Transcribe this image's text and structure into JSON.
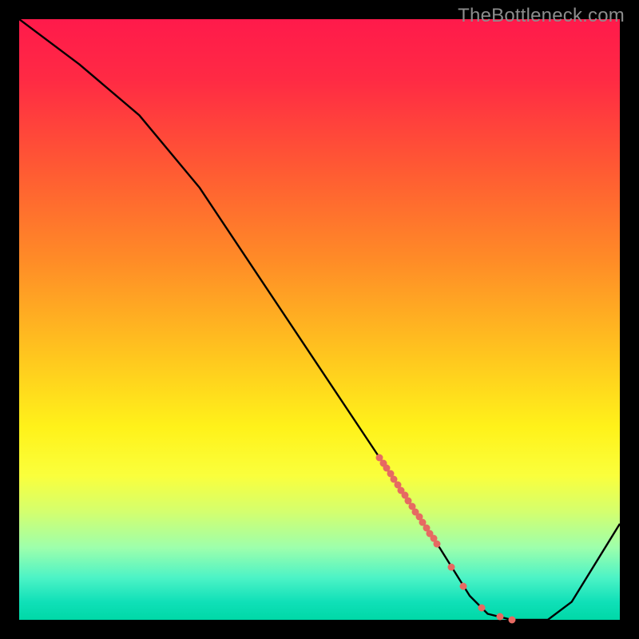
{
  "watermark": "TheBottleneck.com",
  "chart_data": {
    "type": "line",
    "title": "",
    "xlabel": "",
    "ylabel": "",
    "xlim": [
      0,
      100
    ],
    "ylim": [
      0,
      100
    ],
    "series": [
      {
        "name": "bottleneck-curve",
        "x": [
          0,
          10,
          20,
          30,
          40,
          50,
          60,
          70,
          75,
          78,
          82,
          88,
          92,
          100
        ],
        "y": [
          100,
          92.5,
          84,
          72,
          57,
          42,
          27,
          12,
          4,
          1,
          0,
          0,
          3,
          16
        ]
      }
    ],
    "markers": {
      "name": "highlight-dots",
      "x_start": 60,
      "x_end": 82,
      "dense_start": 60,
      "dense_end": 70,
      "sparse_points_x": [
        72,
        74,
        77,
        80,
        82
      ]
    }
  }
}
